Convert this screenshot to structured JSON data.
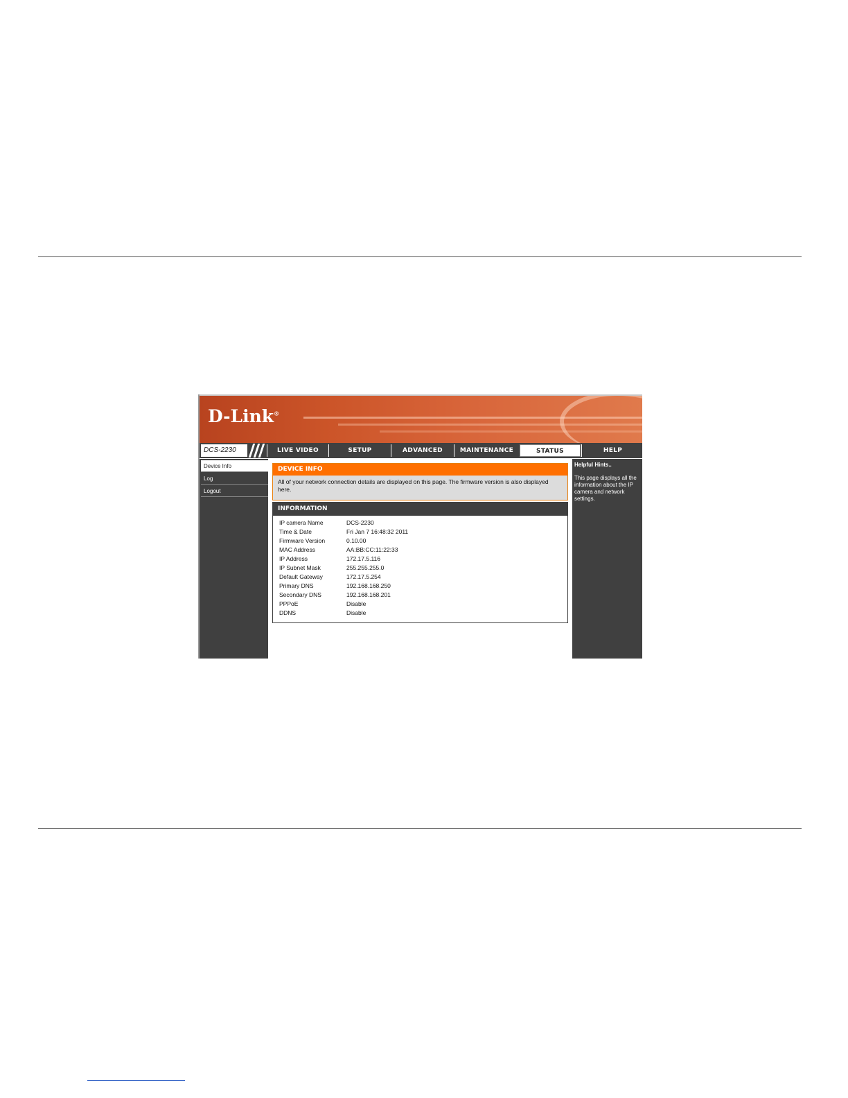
{
  "header": {
    "logo": "D-Link",
    "model": "DCS-2230"
  },
  "nav": {
    "tabs": [
      {
        "label": "LIVE VIDEO"
      },
      {
        "label": "SETUP"
      },
      {
        "label": "ADVANCED"
      },
      {
        "label": "MAINTENANCE"
      },
      {
        "label": "STATUS",
        "active": true
      },
      {
        "label": "HELP"
      }
    ]
  },
  "sidebar": {
    "items": [
      {
        "label": "Device Info",
        "active": true
      },
      {
        "label": "Log"
      },
      {
        "label": "Logout"
      }
    ]
  },
  "device_info": {
    "title": "DEVICE INFO",
    "description": "All of your network connection details are displayed on this page. The firmware version is also displayed here."
  },
  "information": {
    "title": "INFORMATION",
    "rows": [
      {
        "label": "IP camera Name",
        "value": "DCS-2230"
      },
      {
        "label": "Time & Date",
        "value": "Fri Jan 7 16:48:32 2011"
      },
      {
        "label": "Firmware Version",
        "value": "0.10.00"
      },
      {
        "label": "MAC Address",
        "value": "AA:BB:CC:11:22:33"
      },
      {
        "label": "IP Address",
        "value": "172.17.5.116"
      },
      {
        "label": "IP Subnet Mask",
        "value": "255.255.255.0"
      },
      {
        "label": "Default Gateway",
        "value": "172.17.5.254"
      },
      {
        "label": "Primary DNS",
        "value": "192.168.168.250"
      },
      {
        "label": "Secondary DNS",
        "value": "192.168.168.201"
      },
      {
        "label": "PPPoE",
        "value": "Disable"
      },
      {
        "label": "DDNS",
        "value": "Disable"
      }
    ]
  },
  "hints": {
    "title": "Helpful Hints..",
    "body": "This page displays all the information about the IP camera and network settings."
  },
  "colors": {
    "banner": "#c9502a",
    "nav_bg": "#404040",
    "orange_header": "#ff6f00"
  }
}
